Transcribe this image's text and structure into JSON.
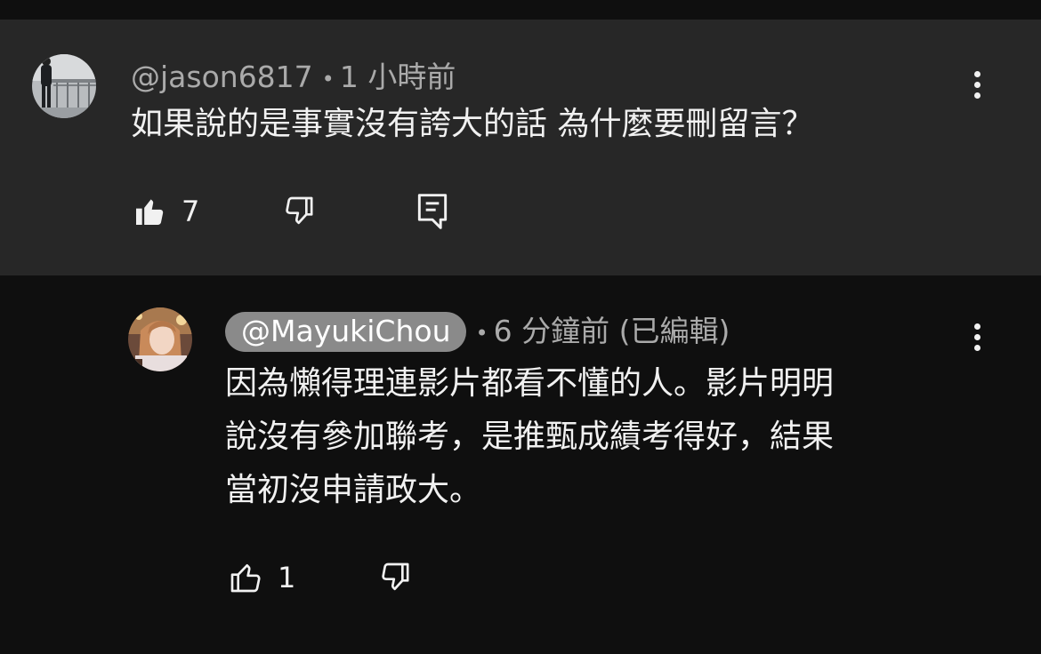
{
  "comments": [
    {
      "handle": "@jason6817",
      "time": "1 小時前",
      "text": "如果說的是事實沒有誇大的話 為什麼要刪留言？",
      "likes": "7"
    },
    {
      "handle": "@MayukiChou",
      "time": "6 分鐘前 (已編輯)",
      "text_lines": [
        "因為懶得理連影片都看不懂的人。影片明明",
        "說沒有參加聯考，是推甄成績考得好，結果",
        "當初沒申請政大。"
      ],
      "likes": "1"
    }
  ],
  "separator": "•",
  "icons": {
    "like_filled": "thumb-up-filled-icon",
    "like_outline": "thumb-up-outline-icon",
    "dislike": "thumb-down-icon",
    "reply": "reply-comment-icon",
    "more": "more-vertical-icon"
  },
  "colors": {
    "background": "#0f0f0f",
    "highlighted_comment_bg": "#272727",
    "creator_chip_bg": "#8a8a8a",
    "meta_text": "#aaaaaa",
    "primary_text": "#f1f1f1"
  }
}
